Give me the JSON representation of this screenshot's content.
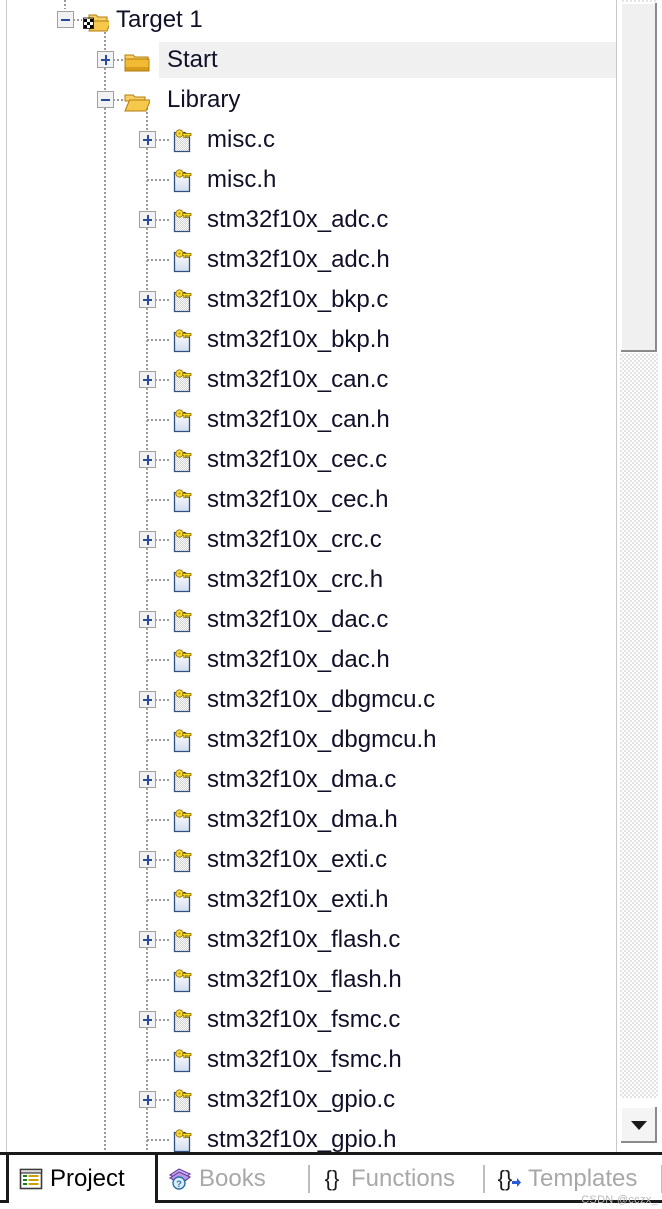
{
  "panel": {
    "name": "Project"
  },
  "tree": {
    "rows": [
      {
        "label": "Target 1",
        "depth": 0,
        "icon": "target-folder-icon",
        "expander": "minus",
        "selected": false
      },
      {
        "label": "Start",
        "depth": 1,
        "icon": "folder-closed-icon",
        "expander": "plus",
        "selected": true
      },
      {
        "label": "Library",
        "depth": 1,
        "icon": "folder-open-icon",
        "expander": "minus",
        "selected": false
      },
      {
        "label": "misc.c",
        "depth": 2,
        "icon": "c-source-file-icon",
        "expander": "plus",
        "selected": false
      },
      {
        "label": "misc.h",
        "depth": 2,
        "icon": "h-header-file-icon",
        "expander": "none",
        "selected": false
      },
      {
        "label": "stm32f10x_adc.c",
        "depth": 2,
        "icon": "c-source-file-icon",
        "expander": "plus",
        "selected": false
      },
      {
        "label": "stm32f10x_adc.h",
        "depth": 2,
        "icon": "h-header-file-icon",
        "expander": "none",
        "selected": false
      },
      {
        "label": "stm32f10x_bkp.c",
        "depth": 2,
        "icon": "c-source-file-icon",
        "expander": "plus",
        "selected": false
      },
      {
        "label": "stm32f10x_bkp.h",
        "depth": 2,
        "icon": "h-header-file-icon",
        "expander": "none",
        "selected": false
      },
      {
        "label": "stm32f10x_can.c",
        "depth": 2,
        "icon": "c-source-file-icon",
        "expander": "plus",
        "selected": false
      },
      {
        "label": "stm32f10x_can.h",
        "depth": 2,
        "icon": "h-header-file-icon",
        "expander": "none",
        "selected": false
      },
      {
        "label": "stm32f10x_cec.c",
        "depth": 2,
        "icon": "c-source-file-icon",
        "expander": "plus",
        "selected": false
      },
      {
        "label": "stm32f10x_cec.h",
        "depth": 2,
        "icon": "h-header-file-icon",
        "expander": "none",
        "selected": false
      },
      {
        "label": "stm32f10x_crc.c",
        "depth": 2,
        "icon": "c-source-file-icon",
        "expander": "plus",
        "selected": false
      },
      {
        "label": "stm32f10x_crc.h",
        "depth": 2,
        "icon": "h-header-file-icon",
        "expander": "none",
        "selected": false
      },
      {
        "label": "stm32f10x_dac.c",
        "depth": 2,
        "icon": "c-source-file-icon",
        "expander": "plus",
        "selected": false
      },
      {
        "label": "stm32f10x_dac.h",
        "depth": 2,
        "icon": "h-header-file-icon",
        "expander": "none",
        "selected": false
      },
      {
        "label": "stm32f10x_dbgmcu.c",
        "depth": 2,
        "icon": "c-source-file-icon",
        "expander": "plus",
        "selected": false
      },
      {
        "label": "stm32f10x_dbgmcu.h",
        "depth": 2,
        "icon": "h-header-file-icon",
        "expander": "none",
        "selected": false
      },
      {
        "label": "stm32f10x_dma.c",
        "depth": 2,
        "icon": "c-source-file-icon",
        "expander": "plus",
        "selected": false
      },
      {
        "label": "stm32f10x_dma.h",
        "depth": 2,
        "icon": "h-header-file-icon",
        "expander": "none",
        "selected": false
      },
      {
        "label": "stm32f10x_exti.c",
        "depth": 2,
        "icon": "c-source-file-icon",
        "expander": "plus",
        "selected": false
      },
      {
        "label": "stm32f10x_exti.h",
        "depth": 2,
        "icon": "h-header-file-icon",
        "expander": "none",
        "selected": false
      },
      {
        "label": "stm32f10x_flash.c",
        "depth": 2,
        "icon": "c-source-file-icon",
        "expander": "plus",
        "selected": false
      },
      {
        "label": "stm32f10x_flash.h",
        "depth": 2,
        "icon": "h-header-file-icon",
        "expander": "none",
        "selected": false
      },
      {
        "label": "stm32f10x_fsmc.c",
        "depth": 2,
        "icon": "c-source-file-icon",
        "expander": "plus",
        "selected": false
      },
      {
        "label": "stm32f10x_fsmc.h",
        "depth": 2,
        "icon": "h-header-file-icon",
        "expander": "none",
        "selected": false
      },
      {
        "label": "stm32f10x_gpio.c",
        "depth": 2,
        "icon": "c-source-file-icon",
        "expander": "plus",
        "selected": false
      },
      {
        "label": "stm32f10x_gpio.h",
        "depth": 2,
        "icon": "h-header-file-icon",
        "expander": "none",
        "selected": false
      }
    ]
  },
  "scrollbar": {
    "down_arrow_icon": "chevron-down-icon",
    "thumb_top_pct": 0,
    "thumb_height_pct": 32
  },
  "tabs": [
    {
      "label": "Project",
      "icon": "project-list-icon",
      "active": true
    },
    {
      "label": "Books",
      "icon": "books-help-icon",
      "active": false
    },
    {
      "label": "Functions",
      "icon": "braces-icon",
      "active": false
    },
    {
      "label": "Templates",
      "icon": "braces-arrow-icon",
      "active": false
    }
  ],
  "watermark": {
    "text": "CSDN @cczx_"
  },
  "colors": {
    "folder": "#f5c243",
    "folder_dark": "#d99b1a",
    "key": "#ffd400",
    "selection": "#f0f0f0",
    "text": "#101028",
    "tab_inactive_text": "#a8a8a8",
    "guide": "#9a9a9a",
    "expander_sign": "#2a4b9b"
  }
}
